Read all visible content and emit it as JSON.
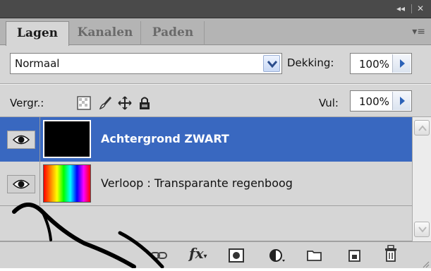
{
  "titlebar": {
    "collapse_glyph": "◂◂",
    "close_glyph": "✕"
  },
  "tabs": [
    {
      "label": "Lagen",
      "active": true
    },
    {
      "label": "Kanalen",
      "active": false
    },
    {
      "label": "Paden",
      "active": false
    }
  ],
  "panel_menu_glyph": "▾≡",
  "blend": {
    "mode": "Normaal",
    "opacity_label": "Dekking:",
    "opacity_value": "100%"
  },
  "lock": {
    "label": "Vergr.:",
    "fill_label": "Vul:",
    "fill_value": "100%"
  },
  "layers": [
    {
      "name": "Achtergrond ZWART",
      "selected": true,
      "visible": true,
      "thumbnail": "solid-black"
    },
    {
      "name": "Verloop : Transparante regenboog",
      "selected": false,
      "visible": true,
      "thumbnail": "rainbow-gradient"
    }
  ],
  "colors": {
    "selection": "#3968c0",
    "panel_bg": "#d6d6d6",
    "titlebar": "#4a4a4a"
  },
  "footer_icons": [
    "link-layers-icon",
    "fx-icon",
    "layer-mask-icon",
    "adjustment-layer-icon",
    "new-group-icon",
    "new-layer-icon",
    "trash-icon"
  ]
}
